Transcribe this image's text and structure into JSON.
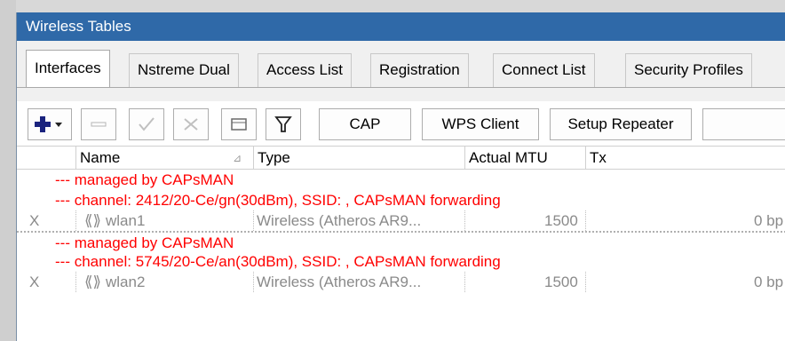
{
  "window": {
    "title": "Wireless Tables"
  },
  "tabs": [
    {
      "label": "Interfaces",
      "active": true
    },
    {
      "label": "Nstreme Dual"
    },
    {
      "label": "Access List"
    },
    {
      "label": "Registration"
    },
    {
      "label": "Connect List"
    },
    {
      "label": "Security Profiles"
    }
  ],
  "toolbar": {
    "cap_label": "CAP",
    "wps_client_label": "WPS Client",
    "setup_repeater_label": "Setup Repeater"
  },
  "table": {
    "columns": [
      "Name",
      "Type",
      "Actual MTU",
      "Tx"
    ],
    "rows": [
      {
        "kind": "comment",
        "text": "--- managed by CAPsMAN"
      },
      {
        "kind": "comment",
        "text": "--- channel: 2412/20-Ce/gn(30dBm), SSID: , CAPsMAN forwarding"
      },
      {
        "kind": "data",
        "flag": "X",
        "name": "wlan1",
        "type": "Wireless (Atheros AR9...",
        "mtu": "1500",
        "tx": "0 bp"
      },
      {
        "kind": "comment",
        "text": "--- managed by CAPsMAN"
      },
      {
        "kind": "comment",
        "text": "--- channel: 5745/20-Ce/an(30dBm), SSID: , CAPsMAN forwarding"
      },
      {
        "kind": "data",
        "flag": "X",
        "name": "wlan2",
        "type": "Wireless (Atheros AR9...",
        "mtu": "1500",
        "tx": "0 bp"
      }
    ]
  },
  "colors": {
    "titlebar": "#2f69a8",
    "comment": "#ff0000",
    "disabled_text": "#8a8a8a"
  }
}
